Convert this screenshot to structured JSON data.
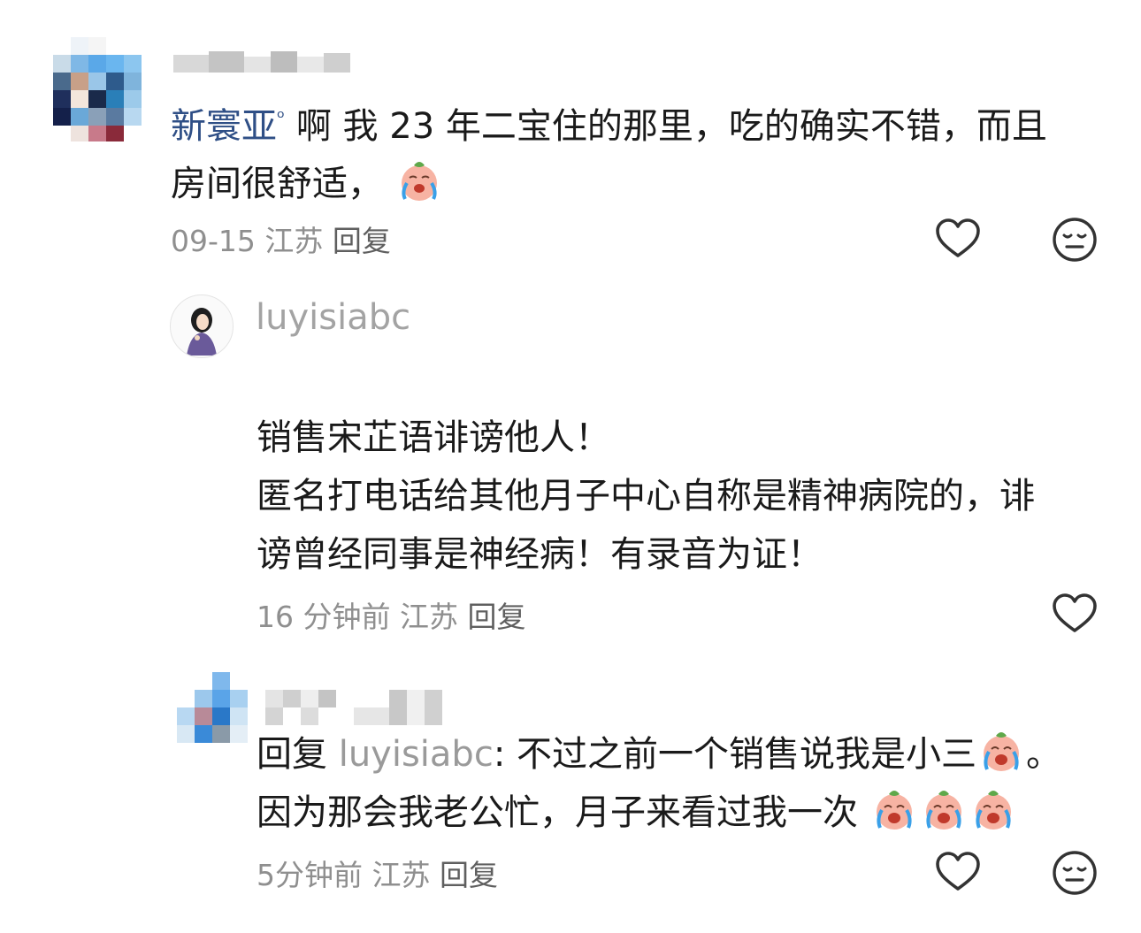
{
  "comment1": {
    "author": "新寰亚",
    "text_line1": "啊 我 23 年二宝住的那里，吃的确实不错，而且",
    "text_line2": "房间很舒适，",
    "date": "09-15",
    "location": "江苏",
    "reply_label": "回复"
  },
  "reply1": {
    "username": "luyisiabc",
    "line1": "销售宋芷语诽谤他人！",
    "line2": "匿名打电话给其他月子中心自称是精神病院的，诽",
    "line3": "谤曾经同事是神经病！有录音为证！",
    "time": "16 分钟前",
    "location": "江苏",
    "reply_label": "回复"
  },
  "reply2": {
    "reply_prefix": "回复",
    "mention": "luyisiabc",
    "line1_text": ": 不过之前一个销售说我是小三",
    "line1_end": "。",
    "line2": "因为那会我老公忙，月子来看过我一次",
    "time": "5分钟前",
    "location": "江苏",
    "reply_label": "回复"
  },
  "icons": {
    "like": "heart-outline-icon",
    "dislike": "meh-face-icon",
    "emoji": "crying-peach-emoji"
  },
  "colors": {
    "mention": "#2f4f86",
    "muted": "#9a9a9a",
    "icon": "#333333"
  }
}
